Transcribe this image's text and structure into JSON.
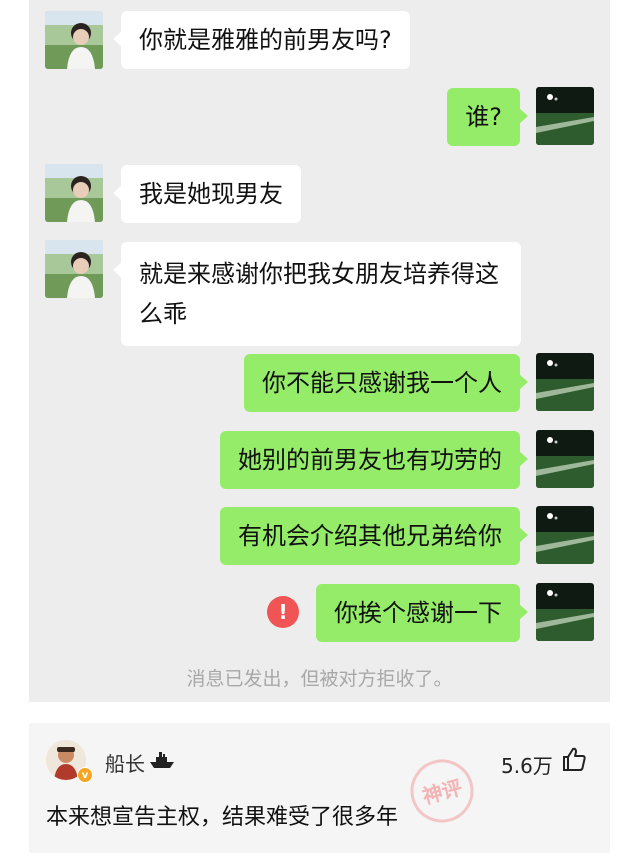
{
  "chat": {
    "messages": [
      {
        "side": "left",
        "text": "你就是雅雅的前男友吗?"
      },
      {
        "side": "right",
        "text": "谁?"
      },
      {
        "side": "left",
        "text": "我是她现男友"
      },
      {
        "side": "left",
        "text": "就是来感谢你把我女朋友培养得这么乖"
      },
      {
        "side": "right",
        "text": "你不能只感谢我一个人"
      },
      {
        "side": "right",
        "text": "她别的前男友也有功劳的"
      },
      {
        "side": "right",
        "text": "有机会介绍其他兄弟给你"
      },
      {
        "side": "right",
        "text": "你挨个感谢一下",
        "status": "failed"
      }
    ],
    "error_symbol": "!",
    "system_note": "消息已发出，但被对方拒收了。"
  },
  "comment": {
    "username": "船长",
    "likes": "5.6万",
    "text": "本来想宣告主权，结果难受了很多年",
    "verified_symbol": "v",
    "stamp_text": "神评"
  },
  "colors": {
    "chat_bg": "#ededed",
    "bubble_left": "#ffffff",
    "bubble_right": "#95ec69",
    "error": "#f05454",
    "comment_bg": "#f5f5f5"
  },
  "icons": [
    "boy-avatar-icon",
    "field-avatar-icon",
    "error-icon",
    "ship-icon",
    "thumbs-up-icon",
    "verified-badge-icon"
  ]
}
